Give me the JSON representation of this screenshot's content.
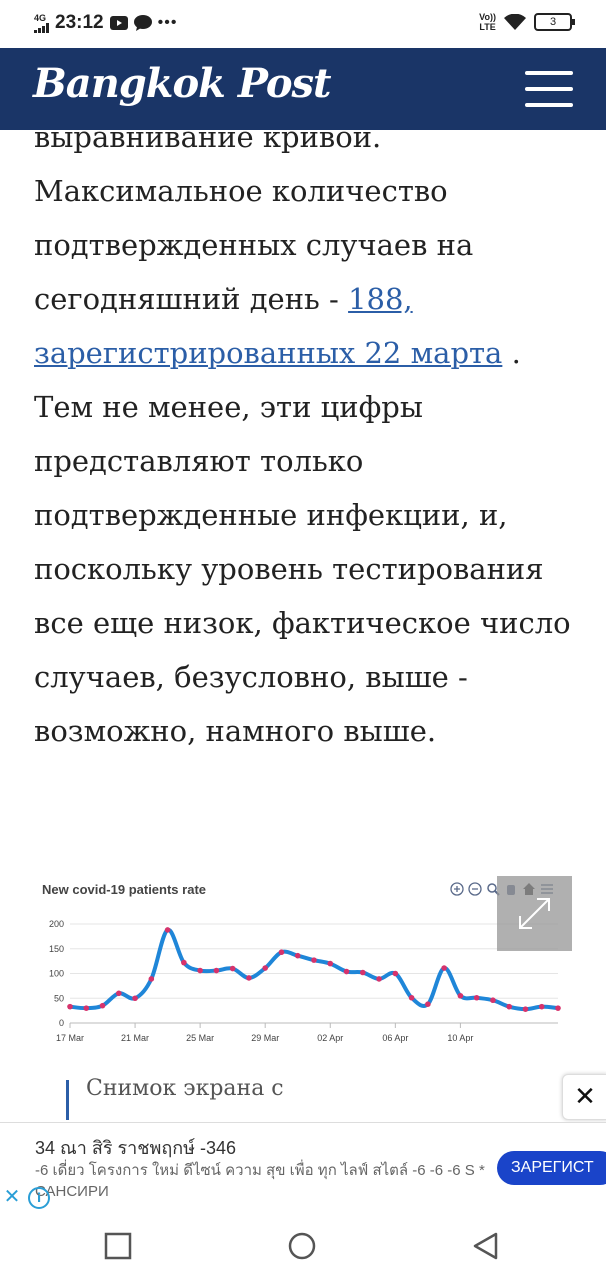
{
  "status_bar": {
    "network": "4G",
    "time": "23:12",
    "extra": "•••",
    "volte_top": "Vo))",
    "volte_bottom": "LTE",
    "battery": "3"
  },
  "header": {
    "logo": "Bangkok Post",
    "menu_icon": "hamburger-icon"
  },
  "article": {
    "line0": "выравнивание кривой.",
    "text_before_link": "Максимальное количество подтвержденных случаев на сегодняшний день - ",
    "link_text": "188, зарегистрированных 22 марта",
    "text_after_link": " . Тем не менее, эти цифры представляют только подтвержденные инфекции, и, поскольку уровень тестирования все еще низок, фактическое число случаев, безусловно, выше - возможно, намного выше."
  },
  "chart_data": {
    "type": "line",
    "title": "New covid-19 patients rate",
    "ylim": [
      0,
      200
    ],
    "yticks": [
      "200",
      "150",
      "100",
      "50",
      "0"
    ],
    "xticks": [
      "17 Mar",
      "21 Mar",
      "25 Mar",
      "29 Mar",
      "02 Apr",
      "06 Apr",
      "10 Apr"
    ],
    "x": [
      0,
      1,
      2,
      3,
      4,
      5,
      6,
      7,
      8,
      9,
      10,
      11,
      12,
      13,
      14,
      15,
      16,
      17,
      18,
      19,
      20,
      21,
      22,
      23,
      24,
      25,
      26,
      27,
      28,
      29,
      30
    ],
    "values": [
      33,
      30,
      35,
      60,
      50,
      89,
      188,
      122,
      106,
      106,
      110,
      91,
      111,
      143,
      136,
      127,
      120,
      104,
      102,
      89,
      100,
      51,
      38,
      111,
      55,
      51,
      46,
      33,
      28,
      33,
      30
    ],
    "color": "#1f86d8",
    "marker_color": "#d6336c"
  },
  "chart_toolbar": [
    "zoom-in-icon",
    "zoom-out-icon",
    "magnify-icon",
    "pan-icon",
    "home-icon",
    "menu-icon"
  ],
  "caption": "Снимок экрана с",
  "close_label": "✕",
  "ad": {
    "title": "34 ณา สิริ ราชพฤกษ์ -346",
    "text": "-6 เดี่ยว โครงการ ใหม่ ดีไซน์ ความ สุข เพื่อ ทุก ไลฟ์ สไตล์ -6 -6 -6 S * САНСИРИ",
    "button": "ЗАРЕГИСТ"
  },
  "colors": {
    "header_bg": "#1a3567",
    "link": "#2b5ea7",
    "ad_button": "#1a44c9"
  }
}
